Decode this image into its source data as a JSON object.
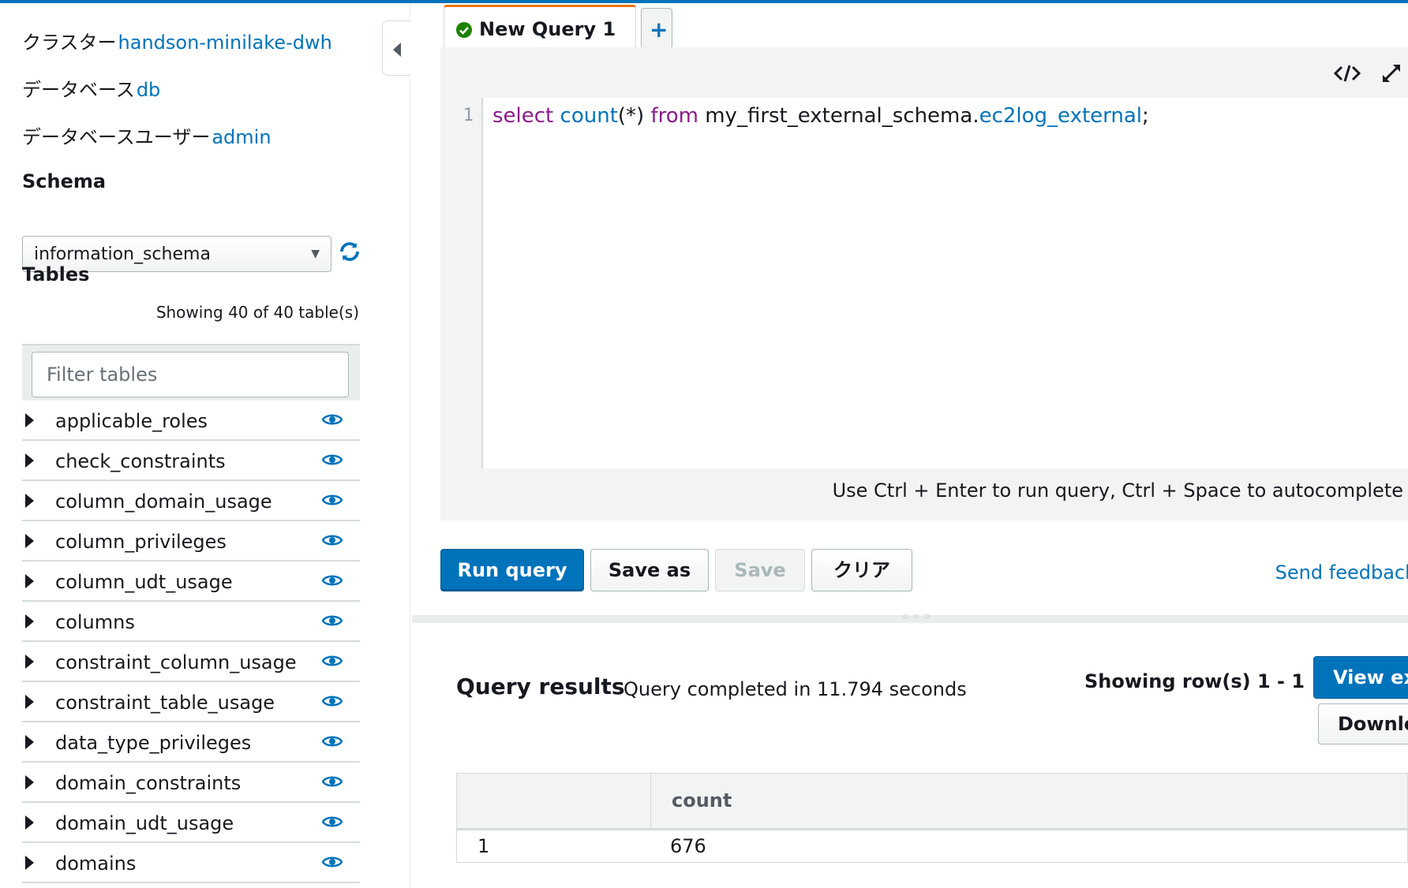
{
  "sidebar": {
    "cluster_label": "クラスター",
    "cluster_value": "handson-minilake-dwh",
    "database_label": "データベース",
    "database_value": "db",
    "db_user_label": "データベースユーザー",
    "db_user_value": "admin",
    "schema_heading": "Schema",
    "schema_selected": "information_schema",
    "tables_heading": "Tables",
    "tables_count": "Showing 40 of 40 table(s)",
    "filter_placeholder": "Filter tables",
    "tables": [
      {
        "name": "applicable_roles"
      },
      {
        "name": "check_constraints"
      },
      {
        "name": "column_domain_usage"
      },
      {
        "name": "column_privileges"
      },
      {
        "name": "column_udt_usage"
      },
      {
        "name": "columns"
      },
      {
        "name": "constraint_column_usage"
      },
      {
        "name": "constraint_table_usage"
      },
      {
        "name": "data_type_privileges"
      },
      {
        "name": "domain_constraints"
      },
      {
        "name": "domain_udt_usage"
      },
      {
        "name": "domains"
      }
    ]
  },
  "editor": {
    "tab_label": "New Query 1",
    "line_number": "1",
    "code": {
      "kw_select": "select",
      "fn_count": "count",
      "args": "(*)",
      "kw_from": "from",
      "schema": "my_first_external_schema.",
      "table": "ec2log_external",
      "end": ";"
    },
    "hint": "Use Ctrl + Enter to run query, Ctrl + Space to autocomplete"
  },
  "toolbar": {
    "run_label": "Run query",
    "save_as_label": "Save as",
    "save_label": "Save",
    "clear_label": "クリア",
    "feedback_label": "Send feedback"
  },
  "results": {
    "title": "Query results",
    "status": "Query completed in 11.794 seconds",
    "rows_showing": "Showing row(s) 1 - 1",
    "view_exec_label": "View ex",
    "download_label": "Downlo",
    "columns": [
      "",
      "count"
    ],
    "rows": [
      [
        "1",
        "676"
      ]
    ]
  },
  "colors": {
    "accent": "#0073bb",
    "tab_highlight": "#ec7211",
    "success": "#1d8102",
    "keyword": "#8b1a8b"
  }
}
